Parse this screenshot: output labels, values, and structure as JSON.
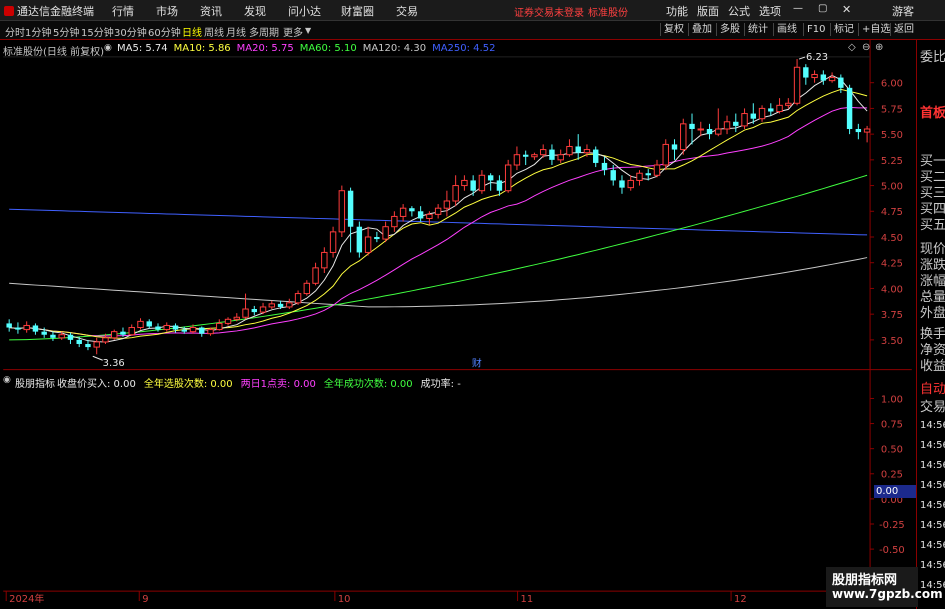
{
  "menubar": {
    "app_title": "通达信金融终端",
    "menus": [
      "行情",
      "市场",
      "资讯",
      "发现",
      "问小达",
      "财富圈",
      "交易"
    ],
    "notice_1": "证券交易未登录",
    "notice_2": "标准股份",
    "right_menus": [
      "功能",
      "版面",
      "公式",
      "选项"
    ],
    "guest": "游客"
  },
  "periods": [
    "分时",
    "1分钟",
    "5分钟",
    "15分钟",
    "30分钟",
    "60分钟",
    "日线",
    "周线",
    "月线",
    "多周期",
    "更多"
  ],
  "active_period": "日线",
  "toolbar_buttons": [
    "复权",
    "叠加",
    "多股",
    "统计",
    "画线",
    "F10",
    "标记",
    "+自选",
    "返回"
  ],
  "chart_header": {
    "stock": "标准股份(日线 前复权)",
    "ma": [
      {
        "label": "MA5: 5.74",
        "color": "#e8e8e8"
      },
      {
        "label": "MA10: 5.86",
        "color": "#ffff40"
      },
      {
        "label": "MA20: 5.75",
        "color": "#ff40ff"
      },
      {
        "label": "MA60: 5.10",
        "color": "#40ff40"
      },
      {
        "label": "MA120: 4.30",
        "color": "#c8c8c8"
      },
      {
        "label": "MA250: 4.52",
        "color": "#4060ff"
      }
    ]
  },
  "indicator_header": {
    "name": "股朋指标",
    "items": [
      {
        "label": "收盘价买入: 0.00",
        "color": "#e8e8e8"
      },
      {
        "label": "全年选股次数: 0.00",
        "color": "#ffff40"
      },
      {
        "label": "两日1点卖: 0.00",
        "color": "#ff40ff"
      },
      {
        "label": "全年成功次数: 0.00",
        "color": "#40ff40"
      },
      {
        "label": "成功率: -",
        "color": "#e8e8e8"
      }
    ],
    "value_box": "0.00"
  },
  "price_axis": [
    "6.00",
    "5.75",
    "5.50",
    "5.25",
    "5.00",
    "4.75",
    "4.50",
    "4.25",
    "4.00",
    "3.75",
    "3.50"
  ],
  "indicator_axis": [
    "1.00",
    "0.75",
    "0.50",
    "0.25",
    "0.00",
    "-0.25",
    "-0.50",
    "-0.75"
  ],
  "date_axis": [
    "2024年",
    "9",
    "10",
    "11",
    "12"
  ],
  "annotations": {
    "high": "6.23",
    "low": "3.36",
    "event": "财"
  },
  "right_panel": {
    "top": "委比",
    "red_label": "首板",
    "rows": [
      "买一",
      "买二",
      "买三",
      "买四",
      "买五",
      "现价",
      "涨跌",
      "涨幅",
      "总量",
      "外盘",
      "换手",
      "净资",
      "收益"
    ],
    "auto": "自动",
    "trade": "交易",
    "times": [
      "14:56",
      "14:56",
      "14:56",
      "14:56",
      "14:56",
      "14:56",
      "14:56",
      "14:56",
      "14:56"
    ]
  },
  "watermark": {
    "line1": "股朋指标网",
    "line2": "www.7gpzb.com"
  },
  "chart_data": {
    "type": "candlestick",
    "title": "标准股份(日线 前复权)",
    "ylim": [
      3.35,
      6.3
    ],
    "y_ticks": [
      3.5,
      3.75,
      4.0,
      4.25,
      4.5,
      4.75,
      5.0,
      5.25,
      5.5,
      5.75,
      6.0
    ],
    "x_ticks": [
      "2024年",
      "9",
      "10",
      "11",
      "12"
    ],
    "candles": [
      [
        3.66,
        3.62,
        3.7,
        3.58
      ],
      [
        3.62,
        3.6,
        3.67,
        3.56
      ],
      [
        3.6,
        3.64,
        3.68,
        3.57
      ],
      [
        3.64,
        3.58,
        3.66,
        3.55
      ],
      [
        3.58,
        3.55,
        3.62,
        3.52
      ],
      [
        3.55,
        3.52,
        3.58,
        3.49
      ],
      [
        3.52,
        3.55,
        3.58,
        3.5
      ],
      [
        3.55,
        3.5,
        3.57,
        3.46
      ],
      [
        3.5,
        3.46,
        3.53,
        3.43
      ],
      [
        3.46,
        3.43,
        3.5,
        3.4
      ],
      [
        3.43,
        3.48,
        3.52,
        3.36
      ],
      [
        3.48,
        3.52,
        3.56,
        3.46
      ],
      [
        3.52,
        3.58,
        3.6,
        3.5
      ],
      [
        3.58,
        3.55,
        3.62,
        3.53
      ],
      [
        3.55,
        3.62,
        3.65,
        3.54
      ],
      [
        3.62,
        3.68,
        3.71,
        3.6
      ],
      [
        3.68,
        3.63,
        3.7,
        3.61
      ],
      [
        3.63,
        3.6,
        3.66,
        3.58
      ],
      [
        3.6,
        3.64,
        3.67,
        3.58
      ],
      [
        3.64,
        3.6,
        3.66,
        3.57
      ],
      [
        3.6,
        3.58,
        3.63,
        3.56
      ],
      [
        3.58,
        3.62,
        3.65,
        3.56
      ],
      [
        3.62,
        3.56,
        3.63,
        3.53
      ],
      [
        3.56,
        3.6,
        3.62,
        3.54
      ],
      [
        3.6,
        3.66,
        3.7,
        3.59
      ],
      [
        3.66,
        3.7,
        3.72,
        3.64
      ],
      [
        3.7,
        3.72,
        3.76,
        3.68
      ],
      [
        3.72,
        3.8,
        3.95,
        3.7
      ],
      [
        3.8,
        3.77,
        3.83,
        3.74
      ],
      [
        3.77,
        3.82,
        3.86,
        3.75
      ],
      [
        3.82,
        3.85,
        3.88,
        3.8
      ],
      [
        3.85,
        3.82,
        3.88,
        3.8
      ],
      [
        3.82,
        3.86,
        3.9,
        3.8
      ],
      [
        3.86,
        3.95,
        3.98,
        3.84
      ],
      [
        3.95,
        4.05,
        4.08,
        3.93
      ],
      [
        4.05,
        4.2,
        4.25,
        4.03
      ],
      [
        4.2,
        4.35,
        4.4,
        4.15
      ],
      [
        4.35,
        4.55,
        4.6,
        4.3
      ],
      [
        4.55,
        4.95,
        5.0,
        4.5
      ],
      [
        4.95,
        4.6,
        4.98,
        4.35
      ],
      [
        4.6,
        4.35,
        4.65,
        4.3
      ],
      [
        4.35,
        4.5,
        4.6,
        4.32
      ],
      [
        4.5,
        4.48,
        4.55,
        4.45
      ],
      [
        4.48,
        4.6,
        4.65,
        4.45
      ],
      [
        4.6,
        4.7,
        4.75,
        4.55
      ],
      [
        4.7,
        4.78,
        4.82,
        4.65
      ],
      [
        4.78,
        4.75,
        4.8,
        4.7
      ],
      [
        4.75,
        4.68,
        4.8,
        4.65
      ],
      [
        4.68,
        4.72,
        4.75,
        4.62
      ],
      [
        4.72,
        4.78,
        4.82,
        4.68
      ],
      [
        4.78,
        4.85,
        4.95,
        4.7
      ],
      [
        4.85,
        5.0,
        5.1,
        4.8
      ],
      [
        5.0,
        5.05,
        5.1,
        4.95
      ],
      [
        5.05,
        4.95,
        5.1,
        4.9
      ],
      [
        4.95,
        5.1,
        5.15,
        4.92
      ],
      [
        5.1,
        5.05,
        5.12,
        4.95
      ],
      [
        5.05,
        4.95,
        5.1,
        4.9
      ],
      [
        4.95,
        5.2,
        5.25,
        4.93
      ],
      [
        5.2,
        5.3,
        5.38,
        5.15
      ],
      [
        5.3,
        5.28,
        5.34,
        5.2
      ],
      [
        5.28,
        5.3,
        5.32,
        5.25
      ],
      [
        5.3,
        5.35,
        5.4,
        5.27
      ],
      [
        5.35,
        5.25,
        5.4,
        5.2
      ],
      [
        5.25,
        5.3,
        5.35,
        5.22
      ],
      [
        5.3,
        5.38,
        5.45,
        5.28
      ],
      [
        5.38,
        5.32,
        5.5,
        5.25
      ],
      [
        5.32,
        5.35,
        5.4,
        5.28
      ],
      [
        5.35,
        5.22,
        5.38,
        5.18
      ],
      [
        5.22,
        5.15,
        5.28,
        5.1
      ],
      [
        5.15,
        5.05,
        5.2,
        5.0
      ],
      [
        5.05,
        4.98,
        5.1,
        4.92
      ],
      [
        4.98,
        5.05,
        5.1,
        4.95
      ],
      [
        5.05,
        5.12,
        5.15,
        5.0
      ],
      [
        5.12,
        5.1,
        5.16,
        5.05
      ],
      [
        5.1,
        5.2,
        5.25,
        5.08
      ],
      [
        5.2,
        5.4,
        5.45,
        5.15
      ],
      [
        5.4,
        5.35,
        5.45,
        5.25
      ],
      [
        5.35,
        5.6,
        5.65,
        5.3
      ],
      [
        5.6,
        5.55,
        5.7,
        5.4
      ],
      [
        5.55,
        5.55,
        5.62,
        5.48
      ],
      [
        5.55,
        5.5,
        5.6,
        5.45
      ],
      [
        5.5,
        5.55,
        5.75,
        5.48
      ],
      [
        5.55,
        5.62,
        5.68,
        5.5
      ],
      [
        5.62,
        5.58,
        5.7,
        5.52
      ],
      [
        5.58,
        5.7,
        5.75,
        5.55
      ],
      [
        5.7,
        5.65,
        5.8,
        5.6
      ],
      [
        5.65,
        5.75,
        5.78,
        5.62
      ],
      [
        5.75,
        5.72,
        5.8,
        5.68
      ],
      [
        5.72,
        5.78,
        5.85,
        5.7
      ],
      [
        5.78,
        5.8,
        5.85,
        5.75
      ],
      [
        5.8,
        6.15,
        6.23,
        5.78
      ],
      [
        6.15,
        6.05,
        6.18,
        5.98
      ],
      [
        6.05,
        6.08,
        6.12,
        6.0
      ],
      [
        6.08,
        6.02,
        6.12,
        5.98
      ],
      [
        6.02,
        6.05,
        6.1,
        6.0
      ],
      [
        6.05,
        5.95,
        6.08,
        5.9
      ],
      [
        5.95,
        5.55,
        5.98,
        5.5
      ],
      [
        5.55,
        5.52,
        5.6,
        5.45
      ],
      [
        5.52,
        5.55,
        5.58,
        5.42
      ]
    ],
    "series": [
      {
        "name": "MA5",
        "color": "#e8e8e8",
        "end": 5.74
      },
      {
        "name": "MA10",
        "color": "#ffff40",
        "end": 5.86
      },
      {
        "name": "MA20",
        "color": "#ff40ff",
        "end": 5.75
      },
      {
        "name": "MA60",
        "color": "#40ff40",
        "start": 3.5,
        "end": 5.1
      },
      {
        "name": "MA120",
        "color": "#c8c8c8",
        "start": 4.05,
        "end": 4.3
      },
      {
        "name": "MA250",
        "color": "#4060ff",
        "start": 4.77,
        "end": 4.52
      }
    ]
  }
}
